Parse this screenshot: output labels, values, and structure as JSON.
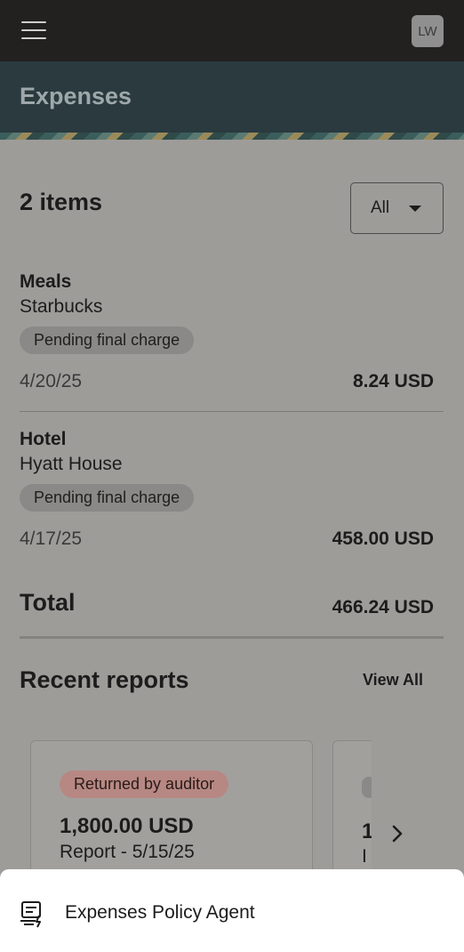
{
  "header": {
    "avatar_initials": "LW",
    "menu_icon": "hamburger-menu-icon"
  },
  "page": {
    "title": "Expenses"
  },
  "items_summary": {
    "count_label": "2 items",
    "filter_value": "All"
  },
  "expenses": [
    {
      "category": "Meals",
      "merchant": "Starbucks",
      "status": "Pending final charge",
      "date": "4/20/25",
      "amount": "8.24 USD"
    },
    {
      "category": "Hotel",
      "merchant": "Hyatt House",
      "status": "Pending final charge",
      "date": "4/17/25",
      "amount": "458.00 USD"
    }
  ],
  "total": {
    "label": "Total",
    "amount": "466.24 USD"
  },
  "recent_reports": {
    "title": "Recent reports",
    "view_all_label": "View All",
    "cards": [
      {
        "status": "Returned by auditor",
        "amount": "1,800.00 USD",
        "name": "Report - 5/15/25"
      }
    ],
    "partial_card": {
      "amount_glyph": "1",
      "name_glyph": "I"
    }
  },
  "bottom_sheet": {
    "agent_label": "Expenses Policy Agent",
    "agent_icon": "policy-agent-icon"
  },
  "colors": {
    "topbar": "#232120",
    "titlebar": "#2a3a3f",
    "overlay_background": "#9e9c99",
    "status_returned": "#b78883"
  }
}
